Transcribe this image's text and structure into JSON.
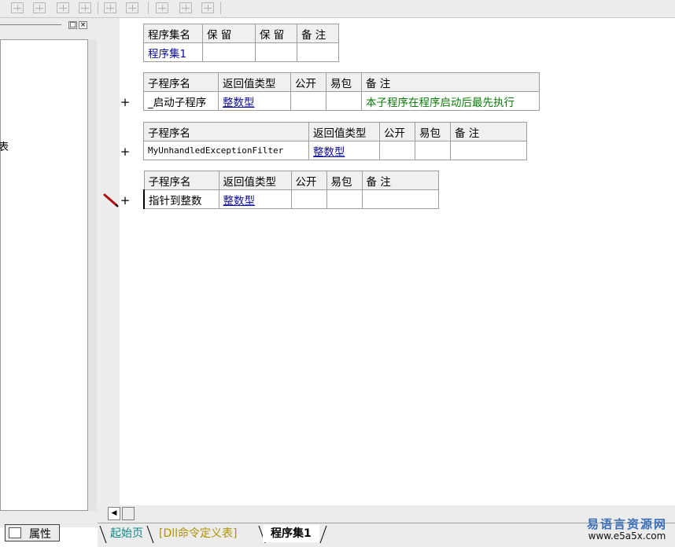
{
  "program_set_table": {
    "headers": [
      "程序集名",
      "保 留",
      "保 留",
      "备 注"
    ],
    "row": [
      "程序集1",
      "",
      "",
      ""
    ]
  },
  "subroutines": [
    {
      "headers": [
        "子程序名",
        "返回值类型",
        "公开",
        "易包",
        "备 注"
      ],
      "name": "_启动子程序",
      "return_type": "整数型",
      "public": "",
      "easy_pack": "",
      "remark": "本子程序在程序启动后最先执行",
      "expander": "+"
    },
    {
      "headers": [
        "子程序名",
        "返回值类型",
        "公开",
        "易包",
        "备 注"
      ],
      "name": "MyUnhandledExceptionFilter",
      "return_type": "整数型",
      "public": "",
      "easy_pack": "",
      "remark": "",
      "expander": "+"
    },
    {
      "headers": [
        "子程序名",
        "返回值类型",
        "公开",
        "易包",
        "备 注"
      ],
      "name": "指针到整数",
      "return_type": "整数型",
      "public": "",
      "easy_pack": "",
      "remark": "",
      "expander": "+"
    }
  ],
  "left_panel": {
    "edge_char": "表",
    "close_glyph": "×",
    "restore_glyph": "□"
  },
  "bottom_tabs": [
    "起始页",
    "[Dll命令定义表]",
    "程序集1"
  ],
  "properties_tab_label": "属性",
  "brand": {
    "name": "易语言资源网",
    "url": "www.e5a5x.com"
  },
  "icons": [
    "toolbar-layout-icon",
    "scroll-left-icon",
    "pencil-icon",
    "properties-icon"
  ],
  "colors": {
    "type_blue": "#0c0c9c",
    "remark_green": "#0a7d0a",
    "tab_start": "#0c8a8a",
    "tab_dll": "#b09200"
  }
}
